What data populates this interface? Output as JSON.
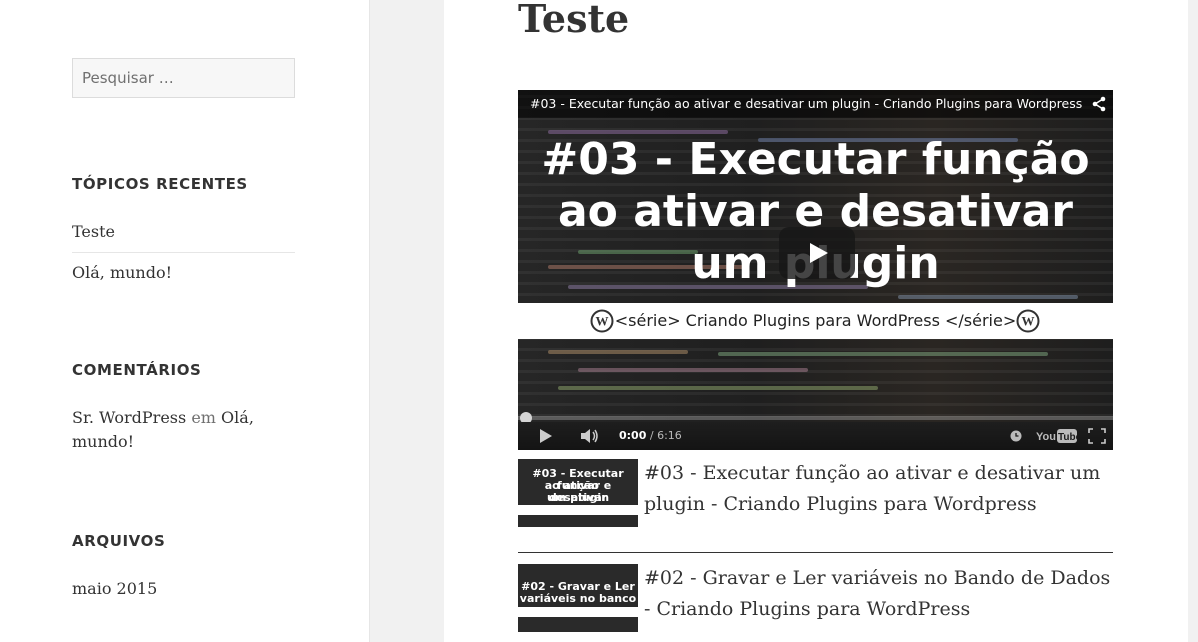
{
  "sidebar": {
    "search_placeholder": "Pesquisar …",
    "recent_posts": {
      "title": "TÓPICOS RECENTES",
      "items": [
        "Teste",
        "Olá, mundo!"
      ]
    },
    "comments": {
      "title": "COMENTÁRIOS",
      "author": "Sr. WordPress",
      "connector": "em",
      "post_line1": "Olá,",
      "post_line2": "mundo!"
    },
    "archives": {
      "title": "ARQUIVOS",
      "items": [
        "maio 2015"
      ]
    }
  },
  "post": {
    "title": "Teste"
  },
  "player": {
    "video_title": "#03 - Executar função ao ativar e desativar um plugin - Criando Plugins para Wordpress",
    "thumb_text": [
      "#03 - Executar função",
      "ao ativar e desativar",
      "um plugin"
    ],
    "series_text": "<série> Criando Plugins para WordPress </série>",
    "current_time": "0:00",
    "duration": "/ 6:16",
    "progress": 0,
    "icons": [
      "share-icon",
      "play-icon",
      "volume-icon",
      "clock-icon",
      "youtube-logo",
      "fullscreen-icon"
    ]
  },
  "playlist": [
    {
      "title": "#03 - Executar função ao ativar e desativar um plugin - Criando Plugins para Wordpress",
      "thumb_lines": [
        "#03 - Executar função",
        "ao ativar e desativar",
        "um plugin"
      ]
    },
    {
      "title": "#02 - Gravar e Ler variáveis no Bando de Dados - Criando Plugins para WordPress",
      "thumb_lines": [
        "#02 - Gravar e Ler",
        "variáveis no banco"
      ]
    }
  ]
}
